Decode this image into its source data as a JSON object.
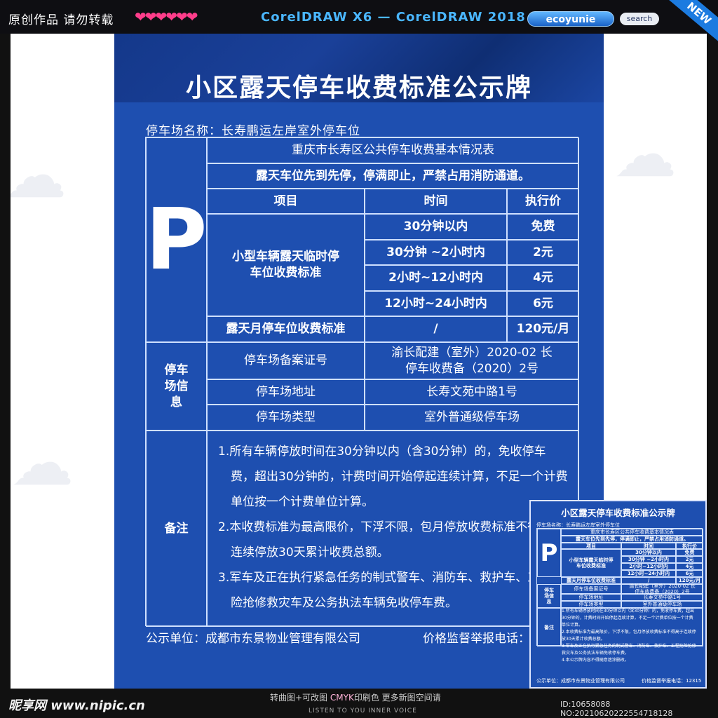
{
  "topbar": {
    "left_text": "原创作品  请勿转载",
    "hearts": "❤❤❤❤❤❤",
    "corel": "CorelDRAW X6 — CorelDRAW 2018",
    "brand": "ecoyunie",
    "search_label": "search",
    "new_badge": "NEW"
  },
  "sign": {
    "title": "小区露天停车收费标准公示牌",
    "lot_name": "停车场名称：长寿鹏运左岸室外停车位",
    "table_title": "重庆市长寿区公共停车收费基本情况表",
    "rule": "露天车位先到先停，停满即止，严禁占用消防通道。",
    "p_symbol": "P",
    "headers": [
      "项目",
      "时间",
      "执行价"
    ],
    "temp_label": "小型车辆露天临时停车位收费标准",
    "rates": [
      {
        "time": "30分钟以内",
        "price": "免费"
      },
      {
        "time": "30分钟 ~2小时内",
        "price": "2元"
      },
      {
        "time": "2小时~12小时内",
        "price": "4元"
      },
      {
        "time": "12小时~24小时内",
        "price": "6元"
      }
    ],
    "monthly": {
      "label": "露天月停车位收费标准",
      "time": "/",
      "price": "120元/月"
    },
    "info_label": "停车场信 息",
    "info_rows": [
      {
        "k": "停车场备案证号",
        "v": "渝长配建（室外）2020-02 长停车收费备（2020）2号"
      },
      {
        "k": "停车场地址",
        "v": "长寿文苑中路1号"
      },
      {
        "k": "停车场类型",
        "v": "室外普通级停车场"
      }
    ],
    "notes_label": "备注",
    "notes": [
      "1.所有车辆停放时间在30分钟以内（含30分钟）的，免收停车费，超出30分钟的，计费时间开始停起连续计算，不足一个计费单位按一个计费单位计算。",
      "2.本收费标准为最高限价，下浮不限，包月停放收费标准不得高于连续停放30天累计收费总额。",
      "3.军车及正在执行紧急任务的制式警车、消防车、救护车、工程抢险抢修救灾车及公务执法车辆免收停车费。",
      "4.本公示牌内容不得随意遮涂删改。"
    ],
    "footer_left": "公示单位：成都市东景物业管理有限公司",
    "footer_right": "价格监督举报电话：12315"
  },
  "thumb": {
    "tel": "12315"
  },
  "bottom": {
    "site": "昵享网 www.nipic.cn",
    "mid_a": "转曲图+可改图 ",
    "mid_b": "CMYK",
    "mid_c": "印刷色 更多新图空间请",
    "mid2": "LISTEN TO YOU INNER VOICE",
    "id": "ID:10658088 NO:20210620222554718128"
  }
}
